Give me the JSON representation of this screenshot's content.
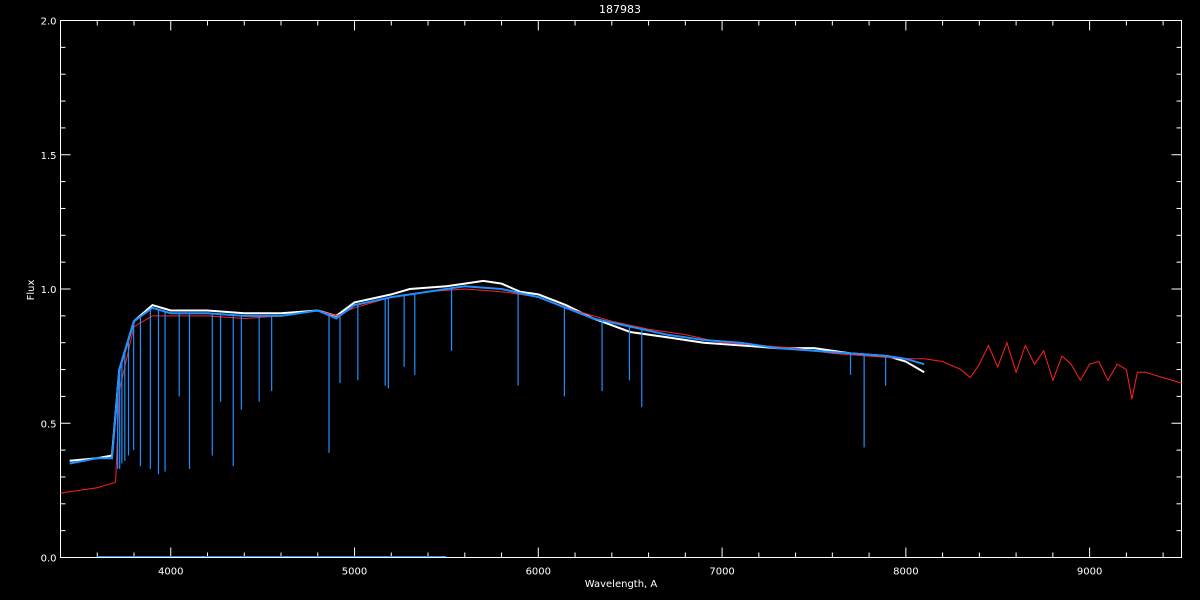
{
  "chart_data": {
    "type": "line",
    "title": "187983",
    "xlabel": "Wavelength, A",
    "ylabel": "Flux",
    "xlim": [
      3400,
      9500
    ],
    "ylim": [
      0.0,
      2.0
    ],
    "xticks": [
      4000,
      5000,
      6000,
      7000,
      8000,
      9000
    ],
    "xtick_labels": [
      "4000",
      "5000",
      "6000",
      "7000",
      "8000",
      "9000"
    ],
    "yticks": [
      0.0,
      0.5,
      1.0,
      1.5,
      2.0
    ],
    "ytick_labels": [
      "0.0",
      "0.5",
      "1.0",
      "1.5",
      "2.0"
    ],
    "grid": false,
    "series": [
      {
        "color": "#ffffff",
        "x": [
          3450,
          3600,
          3680,
          3720,
          3800,
          3900,
          4000,
          4200,
          4400,
          4600,
          4800,
          4900,
          5000,
          5200,
          5300,
          5500,
          5600,
          5700,
          5800,
          5900,
          6000,
          6150,
          6300,
          6500,
          6700,
          6900,
          7100,
          7300,
          7500,
          7700,
          7900,
          8000,
          8100
        ],
        "y": [
          0.36,
          0.37,
          0.38,
          0.7,
          0.88,
          0.94,
          0.92,
          0.92,
          0.91,
          0.91,
          0.92,
          0.9,
          0.95,
          0.98,
          1.0,
          1.01,
          1.02,
          1.03,
          1.02,
          0.99,
          0.98,
          0.94,
          0.89,
          0.84,
          0.82,
          0.8,
          0.79,
          0.78,
          0.78,
          0.76,
          0.75,
          0.73,
          0.69
        ]
      },
      {
        "color": "#ff2020",
        "x": [
          3400,
          3500,
          3600,
          3700,
          3720,
          3800,
          3900,
          4000,
          4200,
          4400,
          4600,
          4800,
          4900,
          5000,
          5200,
          5400,
          5600,
          5800,
          6000,
          6200,
          6400,
          6600,
          6800,
          7000,
          7200,
          7400,
          7600,
          7800,
          8000,
          8100,
          8200,
          8300,
          8350,
          8400,
          8450,
          8500,
          8550,
          8600,
          8650,
          8700,
          8750,
          8800,
          8850,
          8900,
          8950,
          9000,
          9050,
          9100,
          9150,
          9200,
          9230,
          9260,
          9300,
          9400,
          9500
        ],
        "y": [
          0.24,
          0.25,
          0.26,
          0.28,
          0.62,
          0.86,
          0.9,
          0.9,
          0.9,
          0.89,
          0.9,
          0.92,
          0.9,
          0.93,
          0.97,
          0.99,
          1.0,
          0.99,
          0.97,
          0.92,
          0.88,
          0.85,
          0.83,
          0.8,
          0.79,
          0.78,
          0.76,
          0.75,
          0.74,
          0.74,
          0.73,
          0.7,
          0.67,
          0.72,
          0.79,
          0.71,
          0.8,
          0.69,
          0.79,
          0.72,
          0.77,
          0.66,
          0.75,
          0.72,
          0.66,
          0.72,
          0.73,
          0.66,
          0.72,
          0.7,
          0.59,
          0.69,
          0.69,
          0.67,
          0.65
        ]
      },
      {
        "color": "#1e8fff",
        "x": [
          3450,
          3600,
          3680,
          3720,
          3800,
          3900,
          4000,
          4200,
          4400,
          4600,
          4800,
          4900,
          5000,
          5200,
          5400,
          5600,
          5800,
          6000,
          6150,
          6300,
          6500,
          6700,
          6900,
          7100,
          7300,
          7500,
          7700,
          7900,
          8000,
          8100
        ],
        "y": [
          0.35,
          0.37,
          0.37,
          0.7,
          0.88,
          0.93,
          0.91,
          0.91,
          0.9,
          0.9,
          0.92,
          0.89,
          0.94,
          0.97,
          0.99,
          1.01,
          1.0,
          0.97,
          0.93,
          0.89,
          0.86,
          0.83,
          0.81,
          0.8,
          0.78,
          0.77,
          0.76,
          0.75,
          0.74,
          0.72
        ]
      }
    ],
    "absorption_lines": {
      "color": "#1e8fff",
      "x": [
        3711,
        3722,
        3734,
        3750,
        3770,
        3798,
        3835,
        3889,
        3933,
        3969,
        4046,
        4102,
        4226,
        4271,
        4340,
        4384,
        4481,
        4549,
        4861,
        4921,
        5018,
        5167,
        5184,
        5270,
        5328,
        5528,
        5890,
        6142,
        6347,
        6496,
        6563,
        7699,
        7773,
        7890
      ],
      "y": [
        0.33,
        0.33,
        0.35,
        0.36,
        0.38,
        0.4,
        0.34,
        0.33,
        0.31,
        0.32,
        0.6,
        0.33,
        0.38,
        0.58,
        0.34,
        0.55,
        0.58,
        0.62,
        0.39,
        0.65,
        0.66,
        0.64,
        0.63,
        0.71,
        0.68,
        0.77,
        0.64,
        0.6,
        0.62,
        0.66,
        0.56,
        0.68,
        0.41,
        0.64
      ]
    },
    "baseline": {
      "color": "#1e8fff",
      "x": [
        3600,
        5500
      ],
      "y": [
        0.0,
        0.0
      ]
    }
  }
}
